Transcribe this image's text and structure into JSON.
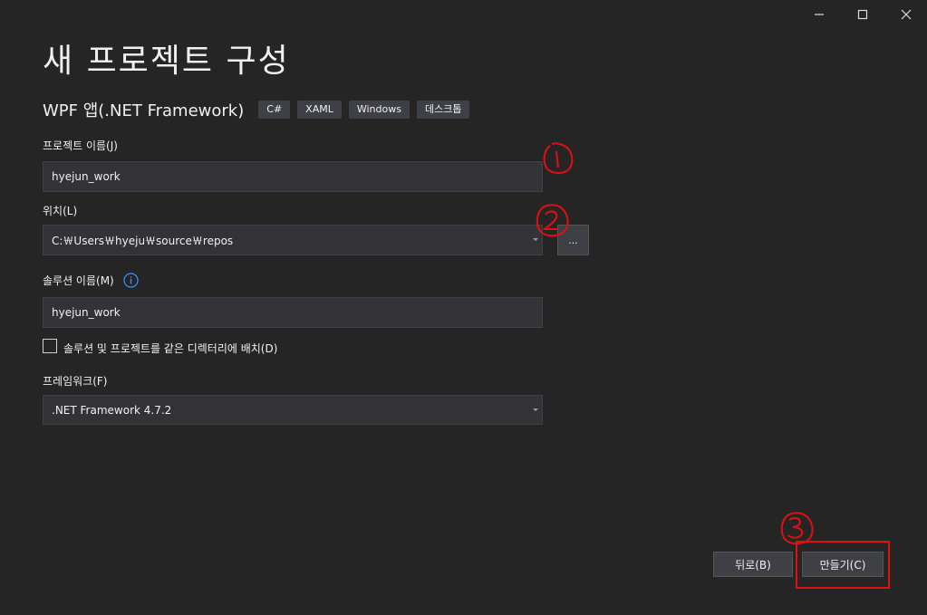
{
  "window": {
    "controls": [
      "minimize-icon",
      "maximize-icon",
      "close-icon"
    ]
  },
  "title": "새 프로젝트 구성",
  "template": {
    "name": "WPF 앱(.NET Framework)",
    "tags": [
      "C#",
      "XAML",
      "Windows",
      "데스크톱"
    ]
  },
  "project_name": {
    "label": "프로젝트 이름(J)",
    "value": "hyejun_work"
  },
  "location": {
    "label": "위치(L)",
    "value": "C:￦Users￦hyeju￦source￦repos",
    "browse_label": "..."
  },
  "solution_name": {
    "label": "솔루션 이름(M)",
    "value": "hyejun_work",
    "icon": "info-icon"
  },
  "same_directory": {
    "label": "솔루션 및 프로젝트를 같은 디렉터리에 배치(D)",
    "checked": false
  },
  "framework": {
    "label": "프레임워크(F)",
    "value": ".NET Framework 4.7.2"
  },
  "buttons": {
    "back": "뒤로(B)",
    "create": "만들기(C)"
  },
  "annotations": {
    "color": "#e01010",
    "marks": [
      "1",
      "2",
      "3"
    ]
  }
}
